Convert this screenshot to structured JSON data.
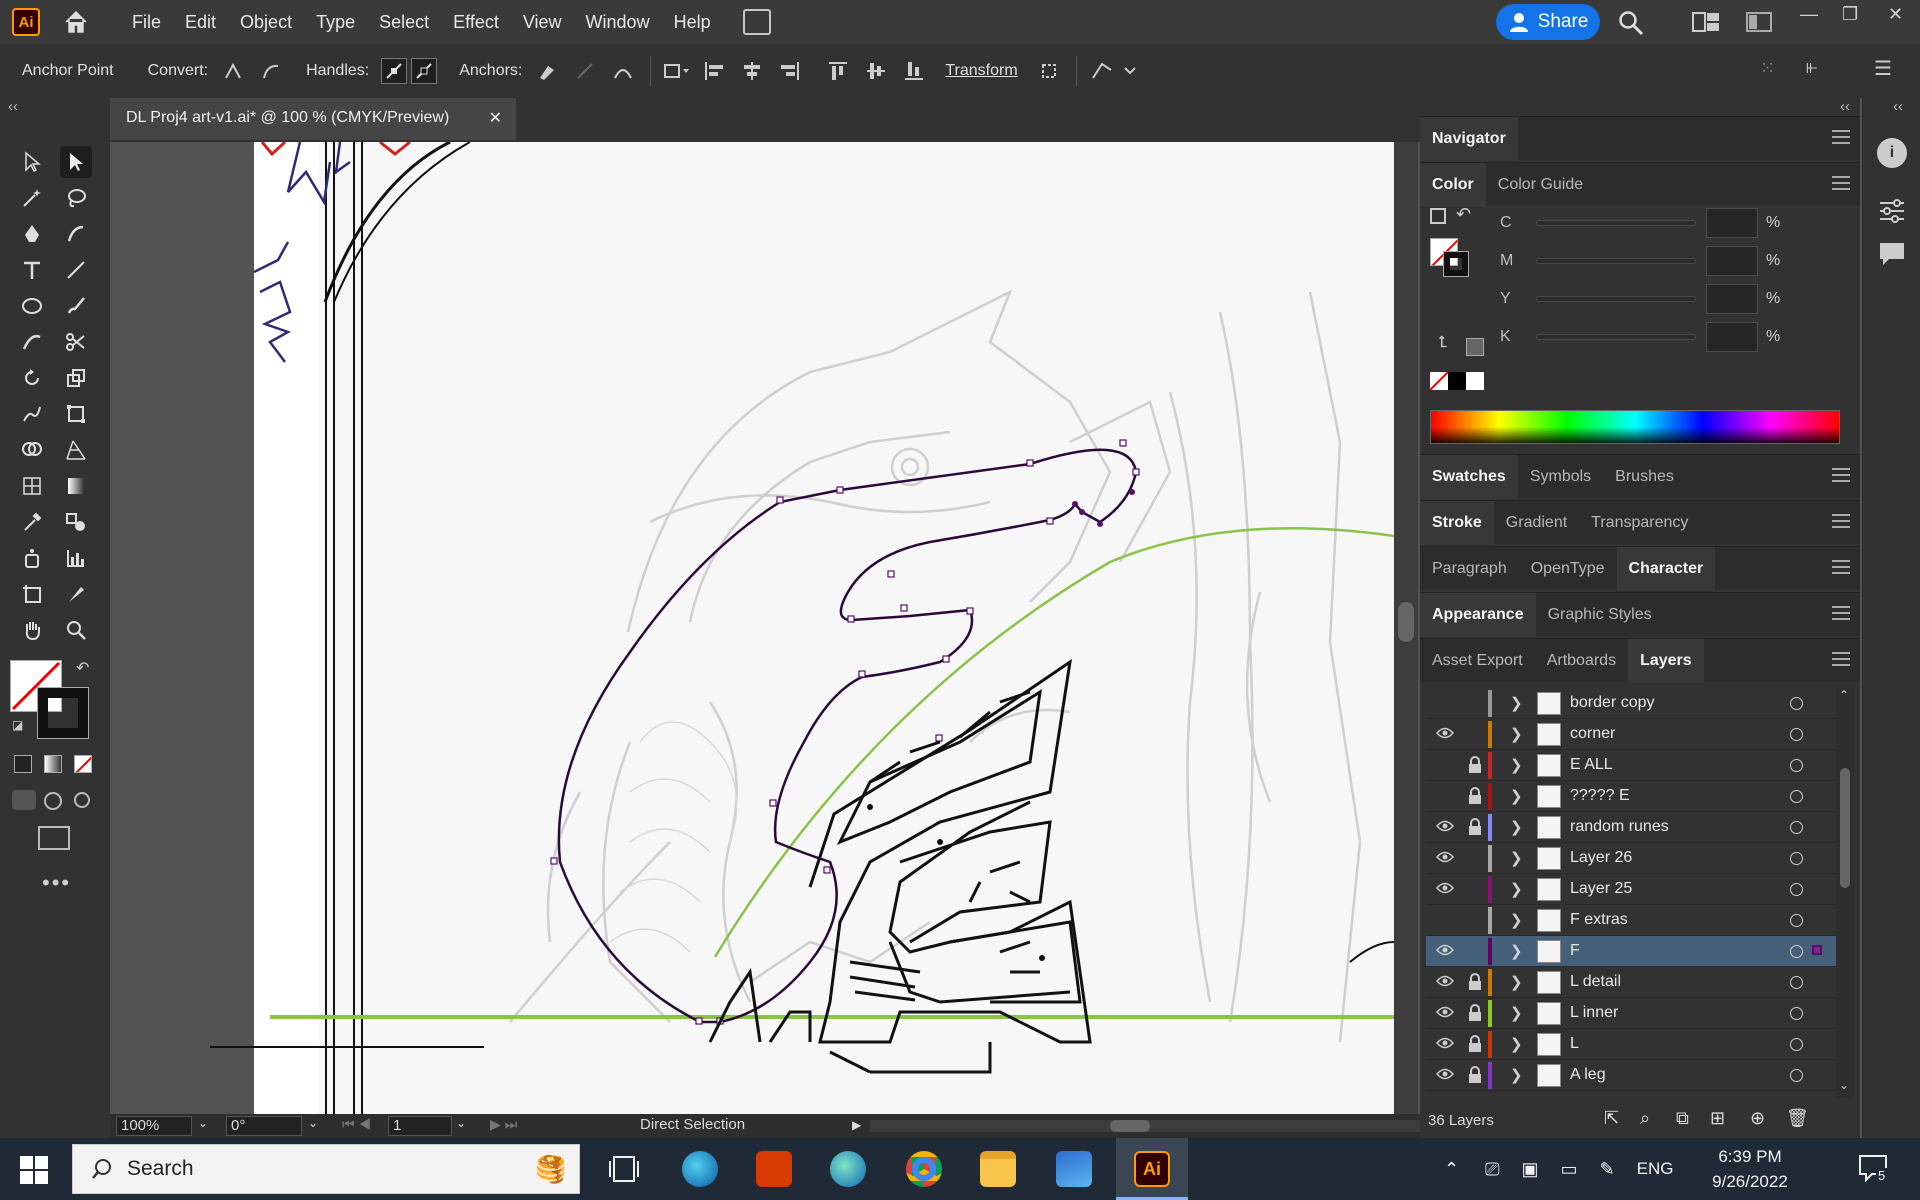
{
  "app": {
    "logo": "Ai",
    "menus": [
      "File",
      "Edit",
      "Object",
      "Type",
      "Select",
      "Effect",
      "View",
      "Window",
      "Help"
    ],
    "share_label": "Share"
  },
  "control_bar": {
    "anchor_point": "Anchor Point",
    "convert": "Convert:",
    "handles": "Handles:",
    "anchors": "Anchors:",
    "transform": "Transform"
  },
  "document": {
    "tab_title": "DL Proj4 art-v1.ai* @ 100 % (CMYK/Preview)",
    "close": "✕"
  },
  "status": {
    "zoom": "100%",
    "rotation": "0°",
    "artboard": "1",
    "tool": "Direct Selection"
  },
  "panels": {
    "navigator": "Navigator",
    "color_tabs": [
      "Color",
      "Color Guide"
    ],
    "cmyk": [
      {
        "ch": "C",
        "pct": "%"
      },
      {
        "ch": "M",
        "pct": "%"
      },
      {
        "ch": "Y",
        "pct": "%"
      },
      {
        "ch": "K",
        "pct": "%"
      }
    ],
    "swatch_tabs": [
      "Swatches",
      "Symbols",
      "Brushes"
    ],
    "stroke_tabs": [
      "Stroke",
      "Gradient",
      "Transparency"
    ],
    "char_tabs": [
      "Paragraph",
      "OpenType",
      "Character"
    ],
    "appearance_tabs": [
      "Appearance",
      "Graphic Styles"
    ],
    "layer_tabs": [
      "Asset Export",
      "Artboards",
      "Layers"
    ],
    "layers_count": "36 Layers"
  },
  "layers": [
    {
      "name": "border copy",
      "color": "#999999",
      "visible": false,
      "locked": false
    },
    {
      "name": "corner",
      "color": "#cc7a00",
      "visible": true,
      "locked": false
    },
    {
      "name": "E ALL",
      "color": "#cc2222",
      "visible": false,
      "locked": true
    },
    {
      "name": "????? E",
      "color": "#aa1111",
      "visible": false,
      "locked": true
    },
    {
      "name": "random runes",
      "color": "#8888ff",
      "visible": true,
      "locked": true
    },
    {
      "name": "Layer 26",
      "color": "#aaaaaa",
      "visible": true,
      "locked": false
    },
    {
      "name": "Layer 25",
      "color": "#881177",
      "visible": true,
      "locked": false
    },
    {
      "name": "F extras",
      "color": "#aaaaaa",
      "visible": false,
      "locked": false
    },
    {
      "name": "F",
      "color": "#660066",
      "visible": true,
      "locked": false,
      "selected": true
    },
    {
      "name": "L detail",
      "color": "#cc7a00",
      "visible": true,
      "locked": true
    },
    {
      "name": "L inner",
      "color": "#88cc22",
      "visible": true,
      "locked": true
    },
    {
      "name": "L",
      "color": "#cc3300",
      "visible": true,
      "locked": true
    },
    {
      "name": "A leg",
      "color": "#8833cc",
      "visible": true,
      "locked": true
    }
  ],
  "taskbar": {
    "search_placeholder": "Search",
    "lang": "ENG",
    "time": "6:39 PM",
    "date": "9/26/2022",
    "notifications": "5"
  }
}
